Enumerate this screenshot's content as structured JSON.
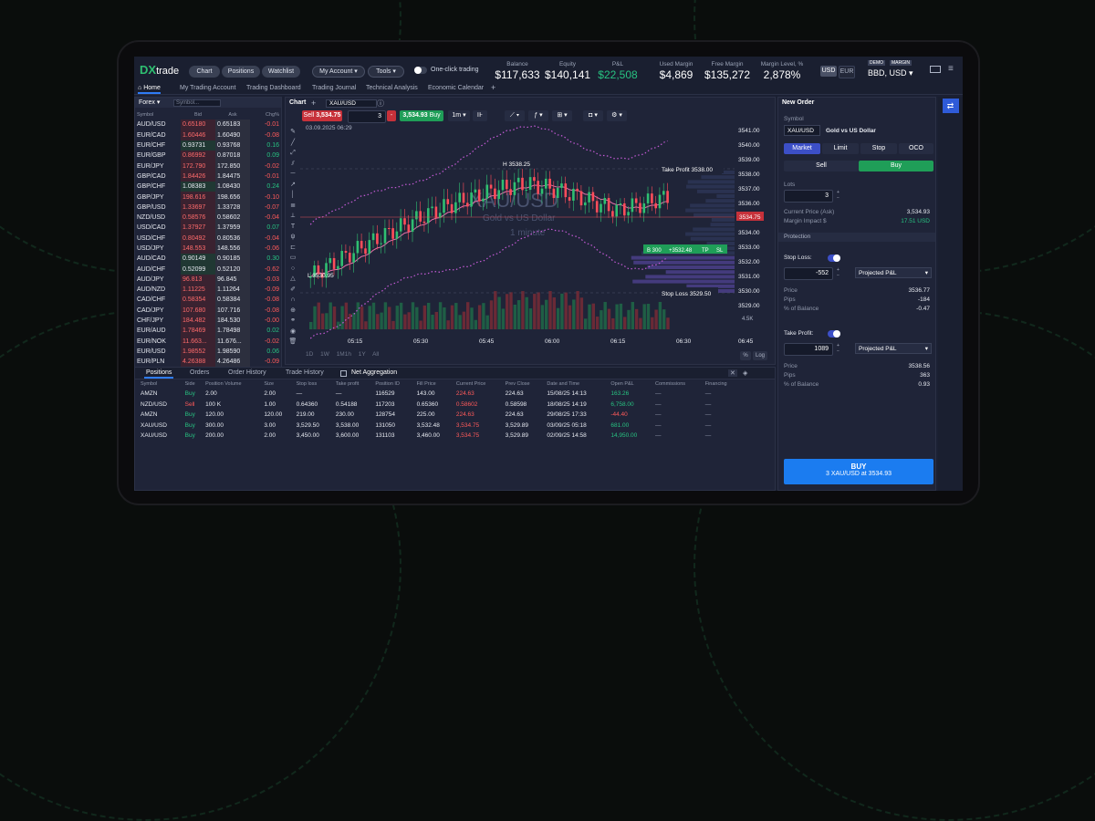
{
  "topbar": {
    "logo_mark": "DX",
    "logo_text": "trade",
    "chart": "Chart",
    "positions": "Positions",
    "watchlist": "Watchlist",
    "my_account": "My Account",
    "tools": "Tools",
    "one_click": "One-click trading",
    "usd": "USD",
    "eur": "EUR",
    "demo": "DEMO",
    "margin": "MARGIN",
    "account": "BBD, USD"
  },
  "stats": [
    {
      "label": "Balance",
      "value": "$117,633"
    },
    {
      "label": "Equity",
      "value": "$140,141"
    },
    {
      "label": "P&L",
      "value": "$22,508"
    },
    {
      "label": "Used Margin",
      "value": "$4,869"
    },
    {
      "label": "Free Margin",
      "value": "$135,272"
    },
    {
      "label": "Margin Level, %",
      "value": "2,878%"
    }
  ],
  "tabs": [
    "Home",
    "My Trading Account",
    "Trading Dashboard",
    "Trading Journal",
    "Technical Analysis",
    "Economic Calendar",
    "+"
  ],
  "forex": {
    "title": "Forex",
    "search_placeholder": "Symbol...",
    "cols": [
      "Symbol",
      "Bid",
      "Ask",
      "Chg%"
    ],
    "rows": [
      [
        "AUD/USD",
        "0.65180",
        "0.65183",
        "-0.01",
        "r"
      ],
      [
        "EUR/CAD",
        "1.60446",
        "1.60490",
        "-0.08",
        "r"
      ],
      [
        "EUR/CHF",
        "0.93731",
        "0.93768",
        "0.16",
        "g"
      ],
      [
        "EUR/GBP",
        "0.86992",
        "0.87018",
        "0.09",
        "r"
      ],
      [
        "EUR/JPY",
        "172.790",
        "172.850",
        "-0.02",
        "r"
      ],
      [
        "GBP/CAD",
        "1.84426",
        "1.84475",
        "-0.01",
        "r"
      ],
      [
        "GBP/CHF",
        "1.08383",
        "1.08430",
        "0.24",
        "g"
      ],
      [
        "GBP/JPY",
        "198.616",
        "198.656",
        "-0.10",
        "r"
      ],
      [
        "GBP/USD",
        "1.33697",
        "1.33728",
        "-0.07",
        "r"
      ],
      [
        "NZD/USD",
        "0.58576",
        "0.58602",
        "-0.04",
        "r"
      ],
      [
        "USD/CAD",
        "1.37927",
        "1.37959",
        "0.07",
        "r"
      ],
      [
        "USD/CHF",
        "0.80492",
        "0.80536",
        "-0.04",
        "r"
      ],
      [
        "USD/JPY",
        "148.553",
        "148.556",
        "-0.06",
        "r"
      ],
      [
        "AUD/CAD",
        "0.90149",
        "0.90185",
        "0.30",
        "g"
      ],
      [
        "AUD/CHF",
        "0.52099",
        "0.52120",
        "-0.62",
        "g"
      ],
      [
        "AUD/JPY",
        "96.813",
        "96.845",
        "-0.03",
        "r"
      ],
      [
        "AUD/NZD",
        "1.11225",
        "1.11264",
        "-0.09",
        "r"
      ],
      [
        "CAD/CHF",
        "0.58354",
        "0.58384",
        "-0.08",
        "r"
      ],
      [
        "CAD/JPY",
        "107.680",
        "107.716",
        "-0.08",
        "r"
      ],
      [
        "CHF/JPY",
        "184.482",
        "184.530",
        "-0.00",
        "r"
      ],
      [
        "EUR/AUD",
        "1.78469",
        "1.78498",
        "0.02",
        "r"
      ],
      [
        "EUR/NOK",
        "11.663...",
        "11.676...",
        "-0.02",
        "r"
      ],
      [
        "EUR/USD",
        "1.98552",
        "1.98590",
        "0.06",
        "r"
      ],
      [
        "EUR/PLN",
        "4.26388",
        "4.26486",
        "-0.09",
        "r"
      ]
    ]
  },
  "chart": {
    "label": "Chart",
    "symbol": "XAU/USD",
    "sell": "Sell",
    "sell_price": "3,534.75",
    "qty": "3",
    "buy_price": "3,534.93",
    "buy": "Buy",
    "tf": "1m",
    "date": "03.09.2025 06:29",
    "watermark_sym": "XAU/USD",
    "watermark_desc": "Gold vs US Dollar",
    "watermark_tf": "1 minute",
    "high": "H",
    "high_val": "3538.25",
    "low": "L",
    "low_val": "3530.95",
    "take_profit": "Take Profit 3538.00",
    "stop_loss": "Stop Loss 3529.50",
    "pos_label": "B 300",
    "pos_pl": "+3532.48",
    "pos_tp": "TP",
    "pos_sl": "SL",
    "price_tag": "3534.75",
    "vol_tag": "4.5K",
    "ranges": [
      "1D",
      "1W",
      "1M1h",
      "1Y",
      "All"
    ],
    "pct": "%",
    "log": "Log"
  },
  "chart_data": {
    "type": "line",
    "x": [
      "05:15",
      "05:30",
      "05:45",
      "06:00",
      "06:15",
      "06:30",
      "06:45"
    ],
    "y": [
      3541.0,
      3540.0,
      3539.0,
      3538.0,
      3537.0,
      3536.0,
      3535.0,
      3534.0,
      3533.0,
      3532.0,
      3531.0,
      3530.0,
      3529.0
    ]
  },
  "bottom": {
    "tabs": [
      "Positions",
      "Orders",
      "Order History",
      "Trade History"
    ],
    "net": "Net Aggregation",
    "cols": [
      "Symbol",
      "Side",
      "Position Volume",
      "Size",
      "Stop loss",
      "Take profit",
      "Position ID",
      "Fill Price",
      "Current Price",
      "Prev Close",
      "Date and Time",
      "Open P&L",
      "Commissions",
      "Financing"
    ],
    "rows": [
      [
        "AMZN",
        "Buy",
        "2.00",
        "2.00",
        "—",
        "—",
        "116529",
        "143.00",
        "224.63",
        "224.63",
        "15/08/25 14:13",
        "163.26",
        "—",
        "—",
        "g"
      ],
      [
        "NZD/USD",
        "Sell",
        "100 K",
        "1.00",
        "0.64360",
        "0.54188",
        "117203",
        "0.65360",
        "0.58602",
        "0.58598",
        "18/08/25 14:19",
        "6,758.00",
        "—",
        "—",
        "g"
      ],
      [
        "AMZN",
        "Buy",
        "120.00",
        "120.00",
        "219.00",
        "230.00",
        "128754",
        "225.00",
        "224.63",
        "224.63",
        "29/08/25 17:33",
        "-44.40",
        "—",
        "—",
        "r"
      ],
      [
        "XAU/USD",
        "Buy",
        "300.00",
        "3.00",
        "3,529.50",
        "3,538.00",
        "131050",
        "3,532.48",
        "3,534.75",
        "3,529.89",
        "03/09/25 05:18",
        "681.00",
        "—",
        "—",
        "g"
      ],
      [
        "XAU/USD",
        "Buy",
        "200.00",
        "2.00",
        "3,450.00",
        "3,600.00",
        "131103",
        "3,460.00",
        "3,534.75",
        "3,529.89",
        "02/09/25 14:58",
        "14,950.00",
        "—",
        "—",
        "g"
      ]
    ]
  },
  "order": {
    "title": "New Order",
    "symbol_label": "Symbol",
    "symbol": "XAU/USD",
    "symbol_desc": "Gold vs US Dollar",
    "types": [
      "Market",
      "Limit",
      "Stop",
      "OCO"
    ],
    "sell": "Sell",
    "buy": "Buy",
    "lots_label": "Lots",
    "lots": "3",
    "cur_price_label": "Current Price (Ask)",
    "cur_price": "3,534.93",
    "margin_label": "Margin Impact $",
    "margin": "17.51 USD",
    "protection": "Protection",
    "sl_label": "Stop Loss:",
    "sl_val": "-552",
    "sl_mode": "Projected P&L",
    "sl_price_l": "Price",
    "sl_price": "3536.77",
    "sl_pips_l": "Pips",
    "sl_pips": "-184",
    "sl_bal_l": "% of Balance",
    "sl_bal": "-0.47",
    "tp_label": "Take Profit:",
    "tp_val": "1089",
    "tp_mode": "Projected P&L",
    "tp_price_l": "Price",
    "tp_price": "3538.56",
    "tp_pips_l": "Pips",
    "tp_pips": "363",
    "tp_bal_l": "% of Balance",
    "tp_bal": "0.93",
    "submit": "BUY",
    "submit_sub": "3 XAU/USD at 3534.93"
  }
}
